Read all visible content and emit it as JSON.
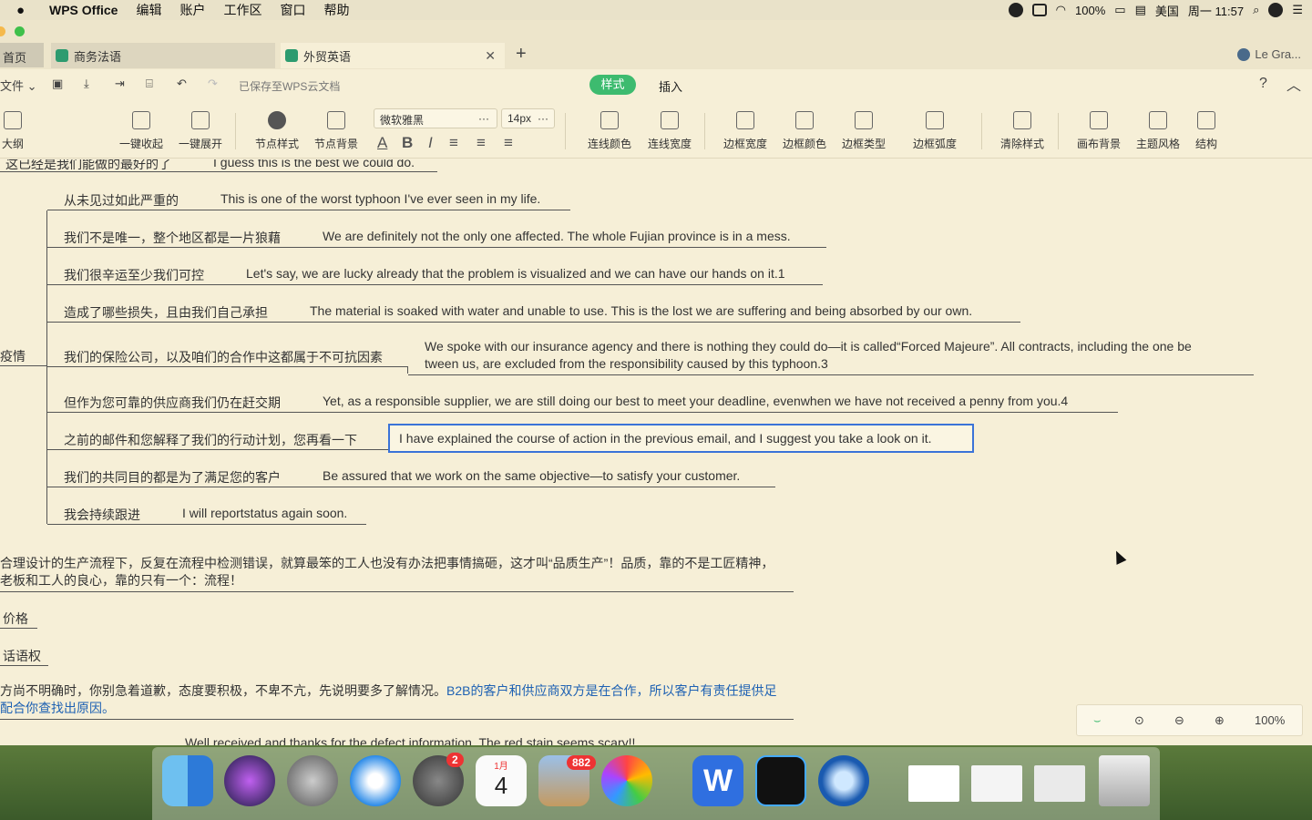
{
  "menubar": {
    "app": "WPS Office",
    "items": [
      "编辑",
      "账户",
      "工作区",
      "窗口",
      "帮助"
    ],
    "battery": "100%",
    "input_method": "美国",
    "clock": "周一 11:57"
  },
  "tabs": {
    "home": "首页",
    "doc1": "商务法语",
    "doc2": "外贸英语",
    "user": "Le Gra..."
  },
  "quickbar": {
    "file": "文件",
    "saved": "已保存至WPS云文档",
    "style": "样式",
    "insert": "插入",
    "help": "?"
  },
  "ribbon": {
    "outline": "大纲",
    "collapse_all": "一键收起",
    "expand_all": "一键展开",
    "node_style": "节点样式",
    "node_bg": "节点背景",
    "font": "微软雅黑",
    "size": "14px",
    "line_color": "连线颜色",
    "line_width": "连线宽度",
    "border_width": "边框宽度",
    "border_color": "边框颜色",
    "border_type": "边框类型",
    "border_radius": "边框弧度",
    "clear_style": "清除样式",
    "canvas_bg": "画布背景",
    "theme": "主题风格",
    "structure": "结构"
  },
  "mindmap": {
    "top_partial_cn": "这已经是我们能做的最好的了",
    "top_partial_en": "I guess this is the best we could do.",
    "parent_label": "疫情",
    "nodes": [
      {
        "cn": "从未见过如此严重的",
        "en": "This is one of the worst typhoon I've ever seen in my life."
      },
      {
        "cn": "我们不是唯一，整个地区都是一片狼藉",
        "en": "We are definitely not the only one affected. The whole Fujian province is in a mess."
      },
      {
        "cn": "我们很辛运至少我们可控",
        "en": "Let's say, we are lucky already that the problem is visualized and we can have our hands on it.1"
      },
      {
        "cn": "造成了哪些损失，且由我们自己承担",
        "en": "The material is soaked with water and unable to use. This is the lost we are suffering and being absorbed by our own."
      },
      {
        "cn": "我们的保险公司，以及咱们的合作中这都属于不可抗因素",
        "en": "We spoke with our insurance agency and there is nothing they could do—it is called“Forced Majeure”. All contracts, including the one be",
        "en2": "tween us, are excluded from the responsibility caused by this typhoon.3"
      },
      {
        "cn": "但作为您可靠的供应商我们仍在赶交期",
        "en": "Yet, as a responsible supplier, we are still doing our best to meet your deadline, evenwhen we have not received a penny from you.4"
      },
      {
        "cn": "之前的邮件和您解释了我们的行动计划，您再看一下",
        "en": "I have explained the course of action in the previous email, and I suggest you take a look on it."
      },
      {
        "cn": "我们的共同目的都是为了满足您的客户",
        "en": "Be assured that we work on the same objective—to satisfy your customer."
      },
      {
        "cn": "我会持续跟进",
        "en": "I will reportstatus again soon."
      }
    ],
    "para1_line1": "合理设计的生产流程下，反复在流程中检测错误，就算最笨的工人也没有办法把事情搞砸，这才叫“品质生产”！品质，靠的不是工匠精神，",
    "para1_line2": "老板和工人的良心，靠的只有一个：流程！",
    "price": "价格",
    "discourse": "话语权",
    "para2_line1_black": "方尚不明确时，你别急着道歉，态度要积极，不卑不亢，先说明要多了解情况。",
    "para2_line1_blue": "B2B的客户和供应商双方是在合作，所以客户有责任提供足",
    "para2_line2_blue": "配合你查找出原因。",
    "bottom_partial": "Well received and thanks for the defect information. The red stain seems scary!!"
  },
  "zoom": {
    "level": "100%"
  },
  "dock": {
    "settings_badge": "2",
    "calendar_month": "1月",
    "calendar_day": "4",
    "mail_badge": "882"
  }
}
